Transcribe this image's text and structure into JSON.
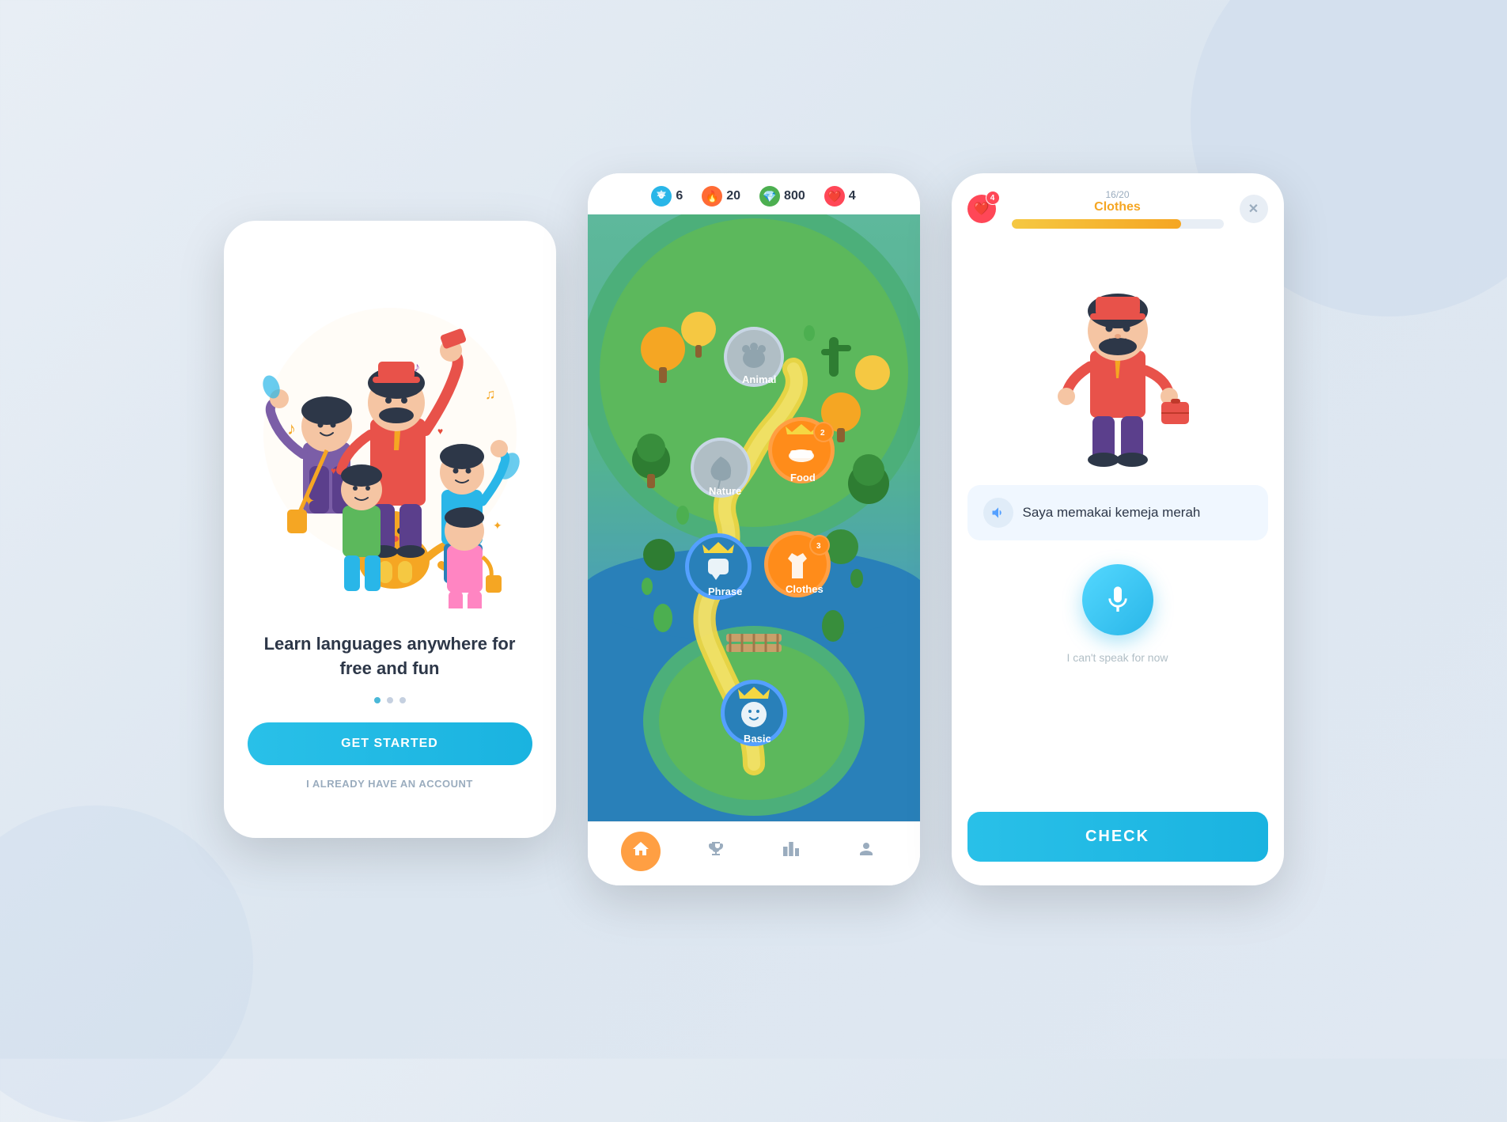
{
  "screen1": {
    "headline": "Learn languages anywhere\nfor free and fun",
    "get_started_label": "GET STARTED",
    "login_label": "I ALREADY HAVE AN ACCOUNT",
    "dots": [
      "active",
      "inactive",
      "inactive"
    ]
  },
  "screen2": {
    "stats": {
      "gear": {
        "value": "6",
        "color": "#29b6e8"
      },
      "flame": {
        "value": "20",
        "color": "#ff6b35"
      },
      "gem": {
        "value": "800",
        "color": "#4caf50"
      },
      "heart": {
        "value": "4",
        "color": "#ff4757"
      }
    },
    "nodes": [
      {
        "id": "basic",
        "label": "Basic",
        "type": "blue",
        "crown": true,
        "badge": null
      },
      {
        "id": "phrase",
        "label": "Phrase",
        "type": "blue",
        "crown": true,
        "badge": null
      },
      {
        "id": "clothes",
        "label": "Clothes",
        "type": "orange",
        "crown": false,
        "badge": "3"
      },
      {
        "id": "food",
        "label": "Food",
        "type": "orange",
        "crown": false,
        "badge": "2"
      },
      {
        "id": "nature",
        "label": "Nature",
        "type": "gray",
        "crown": false,
        "badge": null
      },
      {
        "id": "animal",
        "label": "Animal",
        "type": "gray",
        "crown": false,
        "badge": null
      }
    ],
    "nav": [
      "home",
      "trophy",
      "leaderboard",
      "profile"
    ]
  },
  "screen3": {
    "hearts": "4",
    "progress_fraction": "16/20",
    "progress_title": "Clothes",
    "progress_percent": 80,
    "sentence": "Saya memakai kemeja merah",
    "skip_text": "I can't speak for now",
    "check_label": "CHECK"
  }
}
